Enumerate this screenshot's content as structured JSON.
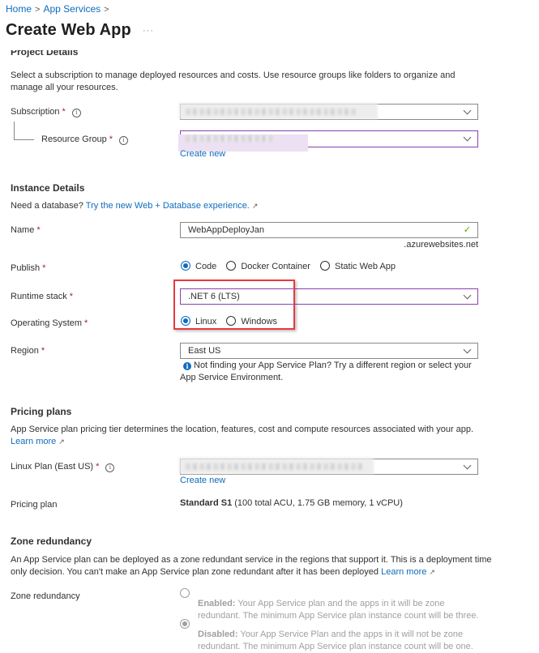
{
  "breadcrumb": {
    "items": [
      "Home",
      "App Services"
    ],
    "separator": ">"
  },
  "page": {
    "title": "Create Web App",
    "more_label": "···"
  },
  "project_details": {
    "heading": "Project Details",
    "description": "Select a subscription to manage deployed resources and costs. Use resource groups like folders to organize and manage all your resources.",
    "subscription_label": "Subscription",
    "resource_group_label": "Resource Group",
    "required_mark": "*",
    "info_glyph": "i",
    "create_new_label": "Create new"
  },
  "instance_details": {
    "heading": "Instance Details",
    "db_prompt": "Need a database?",
    "db_link": "Try the new Web + Database experience.",
    "name_label": "Name",
    "name_value": "WebAppDeployJan",
    "name_suffix": ".azurewebsites.net",
    "valid_icon": "✓",
    "publish_label": "Publish",
    "publish_options": [
      {
        "label": "Code",
        "selected": true
      },
      {
        "label": "Docker Container",
        "selected": false
      },
      {
        "label": "Static Web App",
        "selected": false
      }
    ],
    "runtime_label": "Runtime stack",
    "runtime_value": ".NET 6 (LTS)",
    "os_label": "Operating System",
    "os_options": [
      {
        "label": "Linux",
        "selected": true
      },
      {
        "label": "Windows",
        "selected": false
      }
    ],
    "region_label": "Region",
    "region_value": "East US",
    "region_info": "Not finding your App Service Plan? Try a different region or select your App Service Environment."
  },
  "pricing_plans": {
    "heading": "Pricing plans",
    "description": "App Service plan pricing tier determines the location, features, cost and compute resources associated with your app.",
    "learn_more": "Learn more",
    "linux_plan_label": "Linux Plan (East US)",
    "create_new_label": "Create new",
    "pricing_plan_label": "Pricing plan",
    "pricing_plan_tier": "Standard S1",
    "pricing_plan_details": "(100 total ACU, 1.75 GB memory, 1 vCPU)"
  },
  "zone_redundancy": {
    "heading": "Zone redundancy",
    "description": "An App Service plan can be deployed as a zone redundant service in the regions that support it. This is a deployment time only decision. You can't make an App Service plan zone redundant after it has been deployed",
    "learn_more": "Learn more",
    "label": "Zone redundancy",
    "options": [
      {
        "title": "Enabled:",
        "text": "Your App Service plan and the apps in it will be zone redundant. The minimum App Service plan instance count will be three.",
        "selected": false
      },
      {
        "title": "Disabled:",
        "text": "Your App Service Plan and the apps in it will not be zone redundant. The minimum App Service plan instance count will be one.",
        "selected": true
      }
    ]
  },
  "colors": {
    "accent": "#0f6cbd",
    "required": "#a4262c",
    "focus_border": "#8b3fb0",
    "highlight_box": "#e8393f",
    "valid_check": "#57a300"
  }
}
